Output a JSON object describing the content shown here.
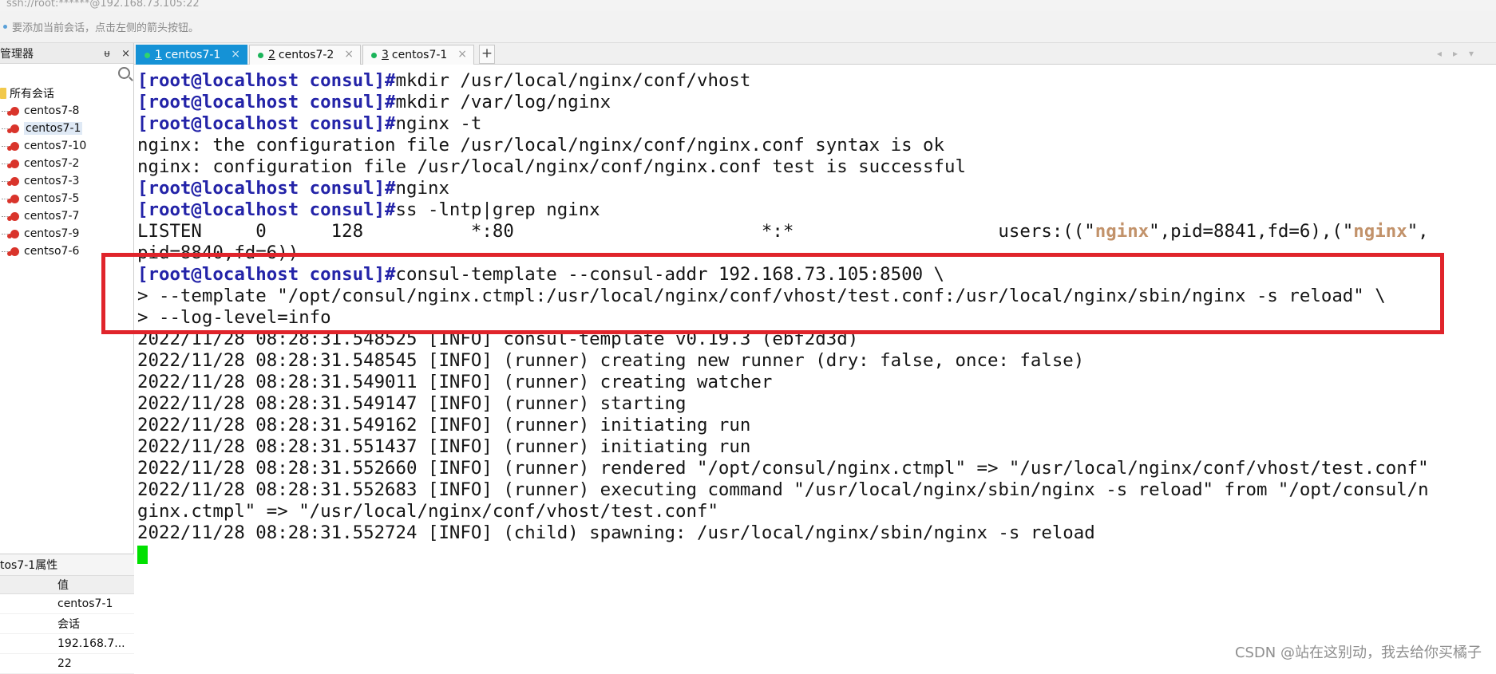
{
  "window": {
    "title": "ssh://root:******@192.168.73.105:22"
  },
  "hint_bar": {
    "text": "要添加当前会话，点击左侧的箭头按钮。"
  },
  "session_manager": {
    "title": "管理器",
    "pin_label": "ᵾ",
    "close_label": "×",
    "root_label": "所有会话",
    "items": [
      {
        "label": "centos7-8"
      },
      {
        "label": "centos7-1"
      },
      {
        "label": "centos7-10"
      },
      {
        "label": "centos7-2"
      },
      {
        "label": "centos7-3"
      },
      {
        "label": "centos7-5"
      },
      {
        "label": "centos7-7"
      },
      {
        "label": "centos7-9"
      },
      {
        "label": "centso7-6"
      }
    ],
    "selected": "centos7-1"
  },
  "properties": {
    "title": "tos7-1属性",
    "header_key": "",
    "header_value": "值",
    "rows": [
      {
        "key": "",
        "value": "centos7-1"
      },
      {
        "key": "",
        "value": "会话"
      },
      {
        "key": "",
        "value": "192.168.7..."
      },
      {
        "key": "",
        "value": "22"
      }
    ]
  },
  "tabs": [
    {
      "index": "1",
      "label": "centos7-1",
      "active": true
    },
    {
      "index": "2",
      "label": "centos7-2",
      "active": false
    },
    {
      "index": "3",
      "label": "centos7-1",
      "active": false
    }
  ],
  "tab_close_glyph": "×",
  "add_tab_label": "+",
  "tab_nav": "◂▸▾",
  "terminal": {
    "prompt": "[root@localhost consul]#",
    "lines": {
      "l1": "mkdir /usr/local/nginx/conf/vhost",
      "l2": "mkdir /var/log/nginx",
      "l3": "nginx -t",
      "l4": "nginx: the configuration file /usr/local/nginx/conf/nginx.conf syntax is ok",
      "l5": "nginx: configuration file /usr/local/nginx/conf/nginx.conf test is successful",
      "l6": "nginx",
      "l7": "ss -lntp|grep nginx",
      "l8a": "LISTEN     0      128          *:80                       *:*                   users:((\"",
      "l8b": "nginx",
      "l8c": "\",pid=8841,fd=6),(\"",
      "l8d": "nginx",
      "l8e": "\",",
      "l9": "pid=8840,fd=6))",
      "l10": "consul-template --consul-addr 192.168.73.105:8500 \\",
      "l11": "> --template \"/opt/consul/nginx.ctmpl:/usr/local/nginx/conf/vhost/test.conf:/usr/local/nginx/sbin/nginx -s reload\" \\",
      "l12": "> --log-level=info",
      "l13": "2022/11/28 08:28:31.548525 [INFO] consul-template v0.19.3 (ebf2d3d)",
      "l14": "2022/11/28 08:28:31.548545 [INFO] (runner) creating new runner (dry: false, once: false)",
      "l15": "2022/11/28 08:28:31.549011 [INFO] (runner) creating watcher",
      "l16": "2022/11/28 08:28:31.549147 [INFO] (runner) starting",
      "l17": "2022/11/28 08:28:31.549162 [INFO] (runner) initiating run",
      "l18": "2022/11/28 08:28:31.551437 [INFO] (runner) initiating run",
      "l19": "2022/11/28 08:28:31.552660 [INFO] (runner) rendered \"/opt/consul/nginx.ctmpl\" => \"/usr/local/nginx/conf/vhost/test.conf\"",
      "l20": "2022/11/28 08:28:31.552683 [INFO] (runner) executing command \"/usr/local/nginx/sbin/nginx -s reload\" from \"/opt/consul/n",
      "l21": "ginx.ctmpl\" => \"/usr/local/nginx/conf/vhost/test.conf\"",
      "l22": "2022/11/28 08:28:31.552724 [INFO] (child) spawning: /usr/local/nginx/sbin/nginx -s reload"
    }
  },
  "annotation": {
    "color": "#e0242b"
  },
  "colors": {
    "tab_active": "#1592d6",
    "prompt": "#2323a8",
    "highlight": "#c2926a",
    "cursor": "#00e000"
  },
  "watermark": "CSDN @站在这别动，我去给你买橘子"
}
